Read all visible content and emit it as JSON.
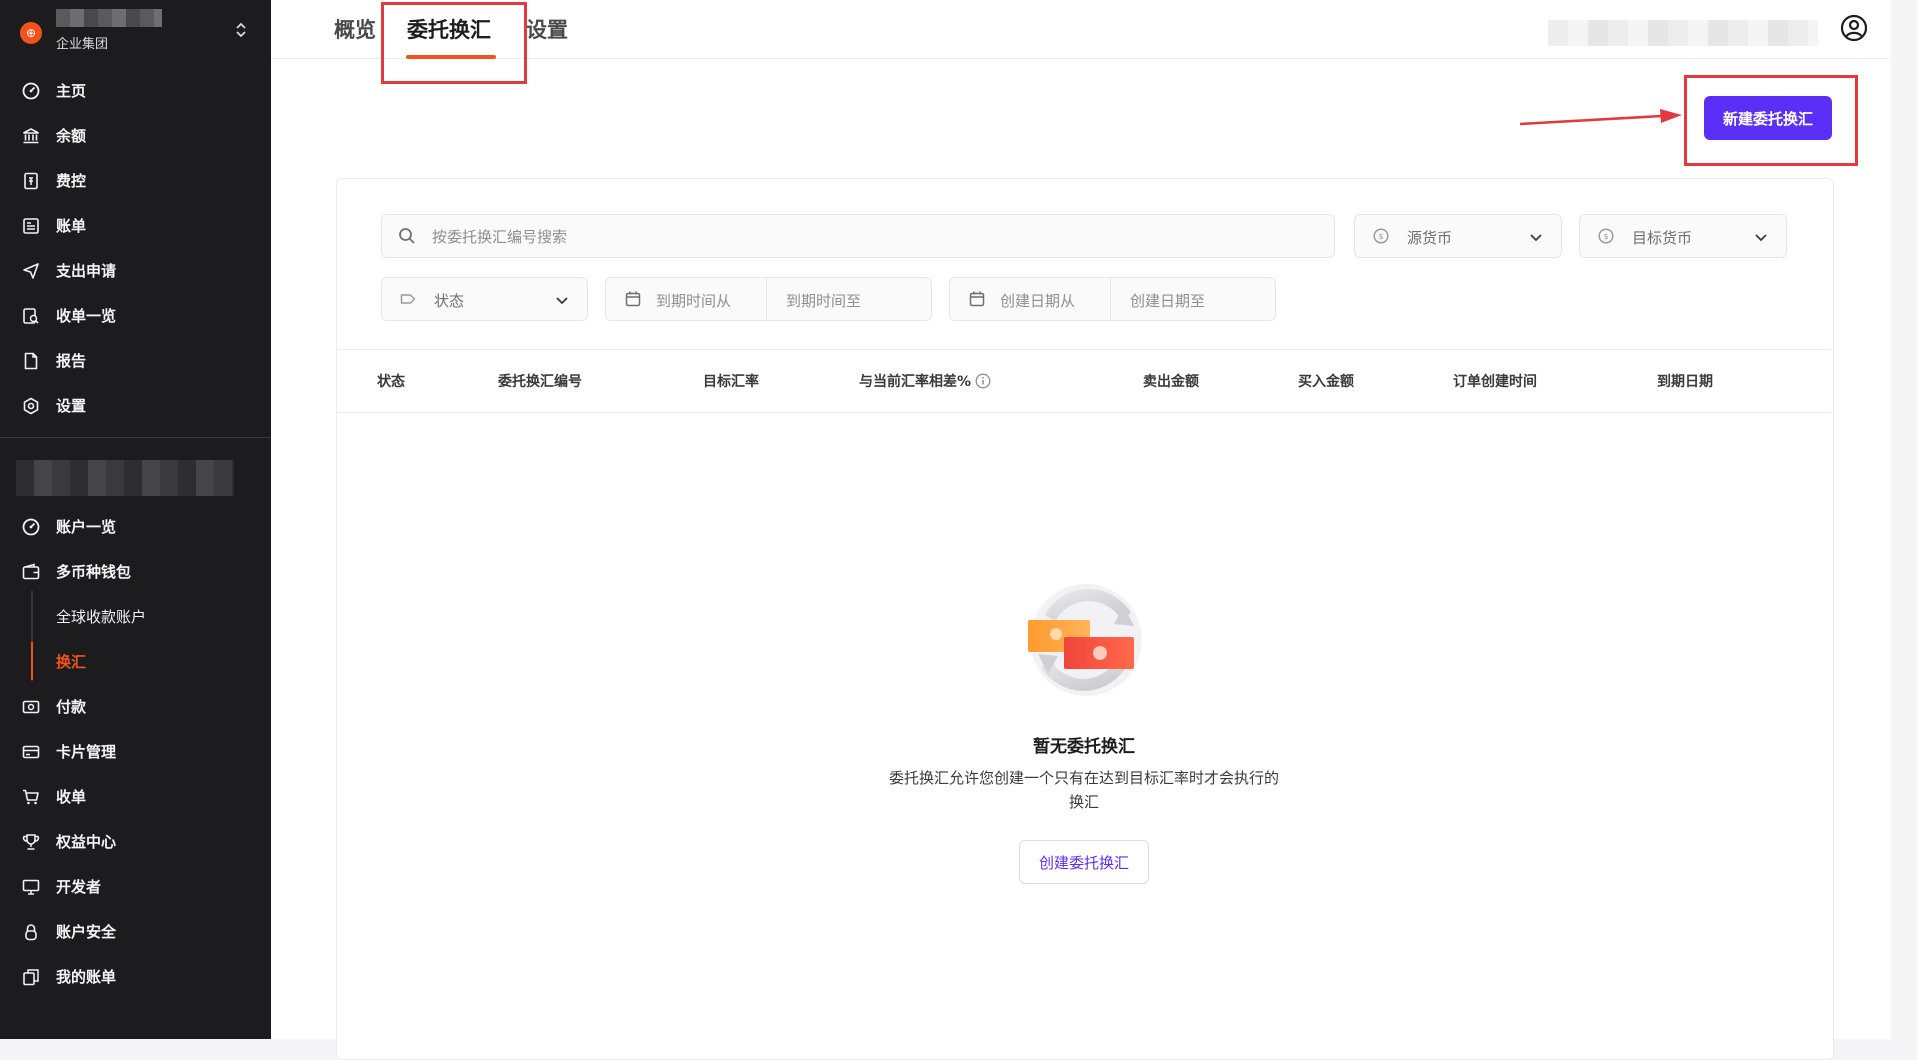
{
  "org": {
    "subtitle": "企业集团",
    "logo_icon": "org-logo-icon",
    "switch_icon": "chevron-updown-icon"
  },
  "sidebar": {
    "main_items": [
      {
        "label": "主页",
        "icon": "dashboard-icon"
      },
      {
        "label": "余额",
        "icon": "bank-icon"
      },
      {
        "label": "费控",
        "icon": "expense-icon"
      },
      {
        "label": "账单",
        "icon": "bill-icon"
      },
      {
        "label": "支出申请",
        "icon": "send-icon"
      },
      {
        "label": "收单一览",
        "icon": "receipt-search-icon"
      },
      {
        "label": "报告",
        "icon": "report-icon"
      },
      {
        "label": "设置",
        "icon": "settings-icon"
      }
    ],
    "account_items": [
      {
        "label": "账户一览",
        "icon": "dashboard-icon"
      },
      {
        "label": "多币种钱包",
        "icon": "wallet-icon"
      },
      {
        "label": "全球收款账户"
      },
      {
        "label": "换汇"
      },
      {
        "label": "付款",
        "icon": "payment-icon"
      },
      {
        "label": "卡片管理",
        "icon": "card-icon"
      },
      {
        "label": "收单",
        "icon": "cart-icon"
      },
      {
        "label": "权益中心",
        "icon": "trophy-icon"
      },
      {
        "label": "开发者",
        "icon": "monitor-icon"
      },
      {
        "label": "账户安全",
        "icon": "lock-icon"
      },
      {
        "label": "我的账单",
        "icon": "copy-icon"
      }
    ],
    "active_item": "换汇",
    "active_color": "#f2531c"
  },
  "tabs": [
    {
      "label": "概览"
    },
    {
      "label": "委托换汇"
    },
    {
      "label": "设置"
    }
  ],
  "active_tab": "委托换汇",
  "header": {
    "user_icon": "user-circle-icon"
  },
  "actions": {
    "new_button": "新建委托换汇",
    "accent_color": "#5b2ff5"
  },
  "filters": {
    "search_placeholder": "按委托换汇编号搜索",
    "source_currency": "源货币",
    "target_currency": "目标货币",
    "status": "状态",
    "expiry_from": "到期时间从",
    "expiry_to": "到期时间至",
    "created_from": "创建日期从",
    "created_to": "创建日期至"
  },
  "table": {
    "columns": [
      "状态",
      "委托换汇编号",
      "目标汇率",
      "与当前汇率相差%",
      "卖出金额",
      "买入金额",
      "订单创建时间",
      "到期日期"
    ],
    "rows": []
  },
  "empty_state": {
    "title": "暂无委托换汇",
    "description": "委托换汇允许您创建一个只有在达到目标汇率时才会执行的换汇",
    "button": "创建委托换汇"
  },
  "annotation_color": "#e0393e"
}
